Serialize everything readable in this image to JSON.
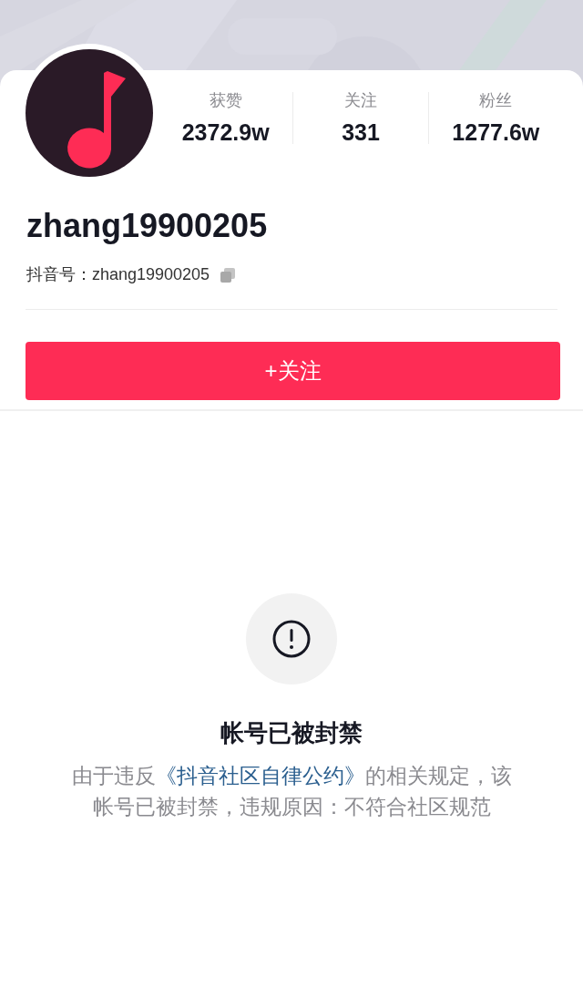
{
  "profile": {
    "stats": [
      {
        "label": "获赞",
        "value": "2372.9w"
      },
      {
        "label": "关注",
        "value": "331"
      },
      {
        "label": "粉丝",
        "value": "1277.6w"
      }
    ],
    "username": "zhang19900205",
    "id_label": "抖音号：zhang19900205"
  },
  "follow_button": "+关注",
  "notice": {
    "title": "帐号已被封禁",
    "text_before": "由于违反",
    "link": "《抖音社区自律公约》",
    "text_after": "的相关规定，该帐号已被封禁，违规原因：不符合社区规范"
  }
}
